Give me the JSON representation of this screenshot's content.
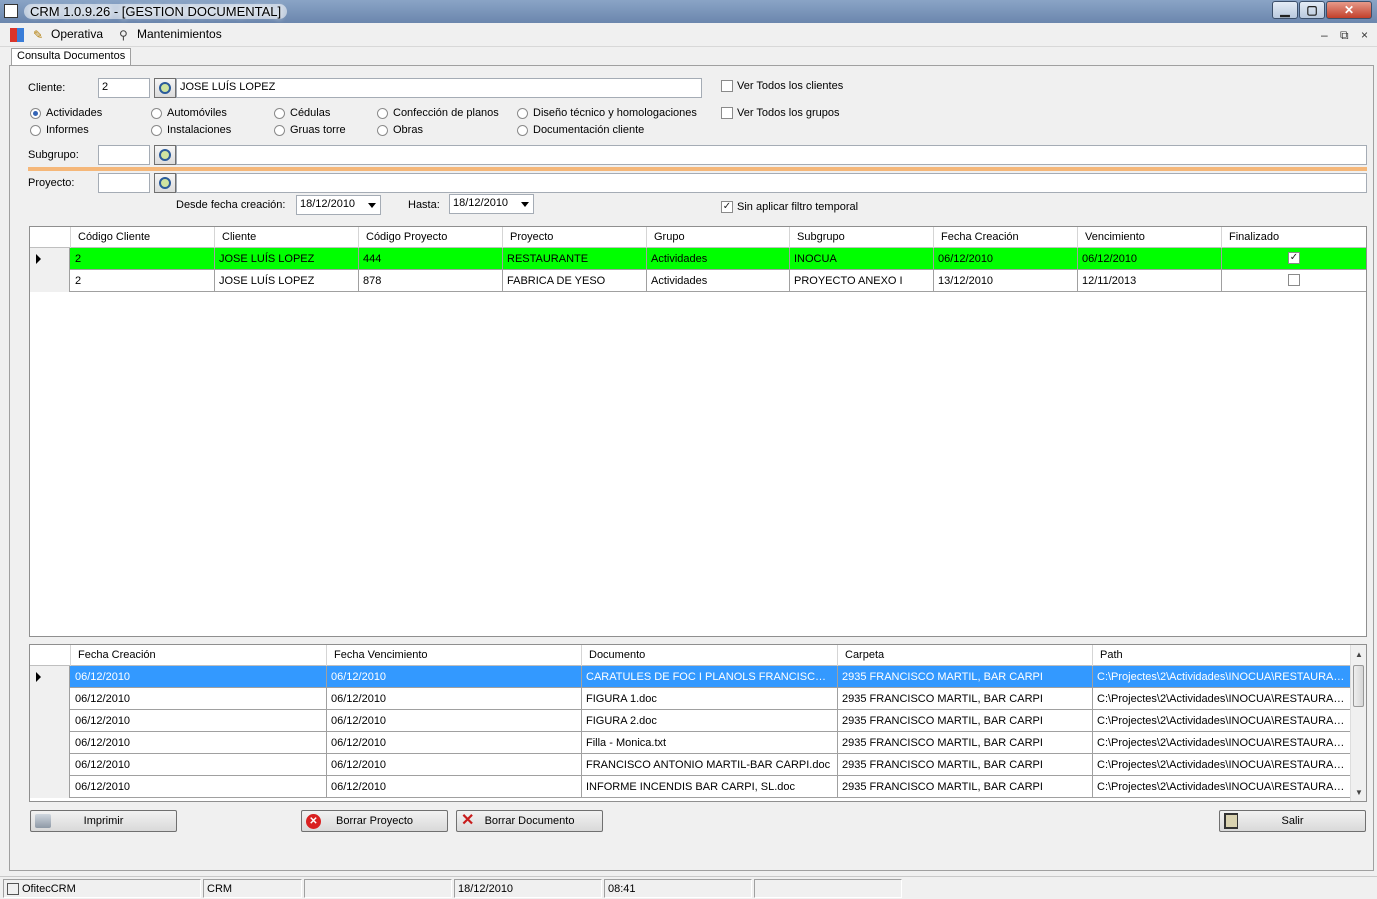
{
  "window": {
    "title": "CRM  1.0.9.26 - [GESTION DOCUMENTAL]",
    "min": "▁",
    "max": "▢",
    "close": "✕"
  },
  "menu": {
    "items": [
      "Operativa",
      "Mantenimientos"
    ],
    "mdi_min": "–",
    "mdi_restore": "⧉",
    "mdi_close": "×"
  },
  "tab": {
    "label": "Consulta Documentos"
  },
  "filters": {
    "cliente_label": "Cliente:",
    "cliente_code": "2",
    "cliente_name": "JOSE LUÍS LOPEZ",
    "ver_todos_clientes": "Ver Todos los clientes",
    "ver_todos_grupos": "Ver Todos los grupos",
    "groups": [
      {
        "label": "Actividades",
        "selected": true
      },
      {
        "label": "Informes",
        "selected": false
      },
      {
        "label": "Automóviles",
        "selected": false
      },
      {
        "label": "Instalaciones",
        "selected": false
      },
      {
        "label": "Cédulas",
        "selected": false
      },
      {
        "label": "Gruas torre",
        "selected": false
      },
      {
        "label": "Confección de planos",
        "selected": false
      },
      {
        "label": "Obras",
        "selected": false
      },
      {
        "label": "Diseño técnico y homologaciones",
        "selected": false
      },
      {
        "label": "Documentación cliente",
        "selected": false
      }
    ],
    "subgrupo_label": "Subgrupo:",
    "proyecto_label": "Proyecto:",
    "desde_label": "Desde fecha creación:",
    "desde_value": "18/12/2010",
    "hasta_label": "Hasta:",
    "hasta_value": "18/12/2010",
    "sin_filtro_label": "Sin aplicar filtro temporal",
    "sin_filtro_checked": true
  },
  "projects_grid": {
    "columns": [
      "Código Cliente",
      "Cliente",
      "Código Proyecto",
      "Proyecto",
      "Grupo",
      "Subgrupo",
      "Fecha Creación",
      "Vencimiento",
      "Finalizado"
    ],
    "rows": [
      {
        "cells": [
          "2",
          "JOSE LUÍS LOPEZ",
          "444",
          "RESTAURANTE",
          "Actividades",
          "INOCUA",
          "06/12/2010",
          "06/12/2010"
        ],
        "finalizado": true,
        "selected": true
      },
      {
        "cells": [
          "2",
          "JOSE LUÍS LOPEZ",
          "878",
          "FABRICA DE YESO",
          "Actividades",
          "PROYECTO ANEXO I",
          "13/12/2010",
          "12/11/2013"
        ],
        "finalizado": false,
        "selected": false
      }
    ]
  },
  "docs_grid": {
    "columns": [
      "Fecha Creación",
      "Fecha Vencimiento",
      "Documento",
      "Carpeta",
      "Path"
    ],
    "rows": [
      [
        "06/12/2010",
        "06/12/2010",
        "CARATULES DE FOC I PLANOLS FRANCISCO MA...",
        "2935 FRANCISCO MARTIL, BAR CARPI",
        "C:\\Projectes\\2\\Actividades\\INOCUA\\RESTAURAN..."
      ],
      [
        "06/12/2010",
        "06/12/2010",
        "FIGURA 1.doc",
        "2935 FRANCISCO MARTIL, BAR CARPI",
        "C:\\Projectes\\2\\Actividades\\INOCUA\\RESTAURAN..."
      ],
      [
        "06/12/2010",
        "06/12/2010",
        "FIGURA 2.doc",
        "2935 FRANCISCO MARTIL, BAR CARPI",
        "C:\\Projectes\\2\\Actividades\\INOCUA\\RESTAURAN..."
      ],
      [
        "06/12/2010",
        "06/12/2010",
        "Filla - Monica.txt",
        "2935 FRANCISCO MARTIL, BAR CARPI",
        "C:\\Projectes\\2\\Actividades\\INOCUA\\RESTAURAN..."
      ],
      [
        "06/12/2010",
        "06/12/2010",
        "FRANCISCO ANTONIO MARTIL-BAR CARPI.doc",
        "2935 FRANCISCO MARTIL, BAR CARPI",
        "C:\\Projectes\\2\\Actividades\\INOCUA\\RESTAURAN..."
      ],
      [
        "06/12/2010",
        "06/12/2010",
        "INFORME INCENDIS BAR CARPI, SL.doc",
        "2935 FRANCISCO MARTIL, BAR CARPI",
        "C:\\Projectes\\2\\Actividades\\INOCUA\\RESTAURAN..."
      ]
    ]
  },
  "buttons": {
    "imprimir": "Imprimir",
    "borrar_proyecto": "Borrar Proyecto",
    "borrar_documento": "Borrar Documento",
    "salir": "Salir"
  },
  "status": {
    "app": "OfitecCRM",
    "module": "CRM",
    "empty1": "",
    "date": "18/12/2010",
    "time": "08:41",
    "empty2": ""
  },
  "colors": {
    "selected_green": "#00ff00",
    "selected_blue": "#3399ff",
    "separator_orange": "#f5b779"
  }
}
